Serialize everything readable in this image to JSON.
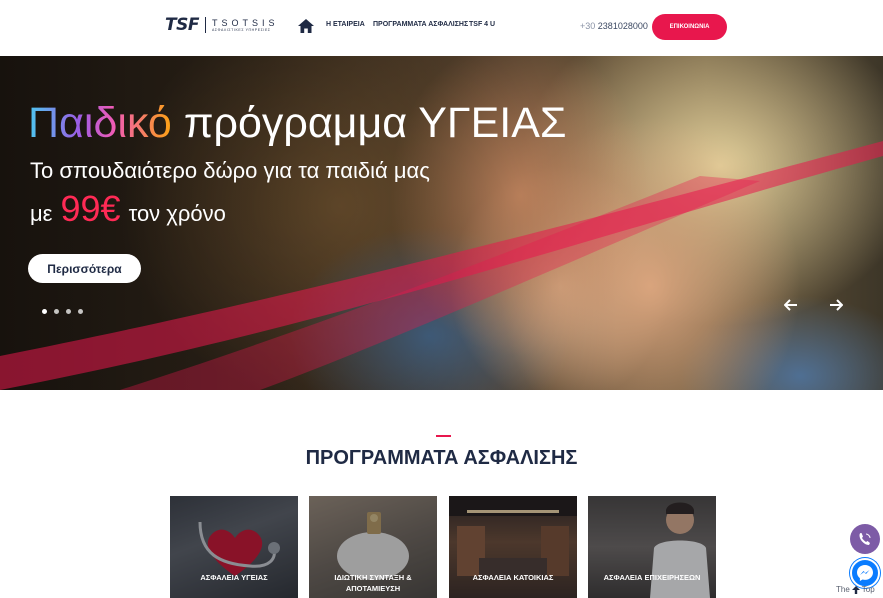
{
  "header": {
    "logo_mark": "TSF",
    "logo_name": "TSOTSIS",
    "logo_sub": "ΑΣΦΑΛΙΣΤΙΚΕΣ ΥΠΗΡΕΣΙΕΣ",
    "home_icon": "home-icon",
    "nav": [
      "Η ΕΤΑΙΡΕΙΑ",
      "ΠΡΟΓΡΑΜΜΑΤΑ ΑΣΦΑΛΙΣΗΣ",
      "TSF 4 U"
    ],
    "phone_prefix": "+30",
    "phone_number": "2381028000",
    "contact_label": "ΕΠΙΚΟΙΝΩΝΙΑ",
    "accent_color": "#e8174d"
  },
  "hero": {
    "title_highlight": "Παιδικό",
    "title_rest": "πρόγραμμα ΥΓΕΙΑΣ",
    "subtitle": "Το σπουδαιότερο δώρο για τα παιδιά μας",
    "price_prefix": "με",
    "price_amount": "99€",
    "price_suffix": "τον χρόνο",
    "cta_label": "Περισσότερα",
    "slide_count": 4,
    "active_slide": 1,
    "prev_icon": "arrow-left-icon",
    "next_icon": "arrow-right-icon"
  },
  "section": {
    "title": "ΠΡΟΓΡΑΜΜΑΤΑ ΑΣΦΑΛΙΣΗΣ",
    "cards": [
      {
        "line1": "ΑΣΦΑΛΕΙΑ ΥΓΕΙΑΣ",
        "line2": ""
      },
      {
        "line1": "ΙΔΙΩΤΙΚΗ ΣΥΝΤΑΞΗ &",
        "line2": "ΑΠΟΤΑΜΙΕΥΣΗ"
      },
      {
        "line1": "ΑΣΦΑΛΕΙΑ ΚΑΤΟΙΚΙΑΣ",
        "line2": ""
      },
      {
        "line1": "ΑΣΦΑΛΕΙΑ ΕΠΙΧΕΙΡΗΣΕΩΝ",
        "line2": ""
      }
    ]
  },
  "floating": {
    "viber_icon": "viber-icon",
    "messenger_icon": "messenger-icon",
    "to_top_left": "The",
    "to_top_right": "Top"
  }
}
